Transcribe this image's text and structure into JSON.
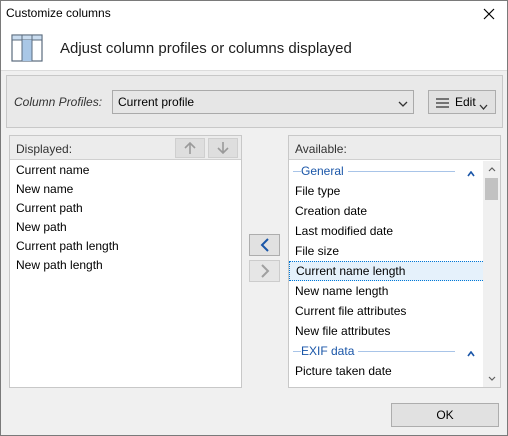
{
  "window": {
    "title": "Customize columns"
  },
  "header": {
    "text": "Adjust column profiles or columns displayed"
  },
  "profiles": {
    "label": "Column Profiles:",
    "selected": "Current profile",
    "edit_label": "Edit"
  },
  "displayed": {
    "header": "Displayed:",
    "items": [
      "Current name",
      "New name",
      "Current path",
      "New path",
      "Current path length",
      "New path length"
    ]
  },
  "available": {
    "header": "Available:",
    "groups": [
      {
        "name": "General",
        "items": [
          "File type",
          "Creation date",
          "Last modified date",
          "File size",
          "Current name length",
          "New name length",
          "Current file attributes",
          "New file attributes"
        ]
      },
      {
        "name": "EXIF data",
        "items": [
          "Picture taken date"
        ]
      }
    ],
    "selected_item": "Current name length"
  },
  "footer": {
    "ok_label": "OK"
  },
  "colors": {
    "accent": "#0078d7",
    "group_text": "#1a56a8",
    "selection_bg": "#e5f1fb"
  }
}
